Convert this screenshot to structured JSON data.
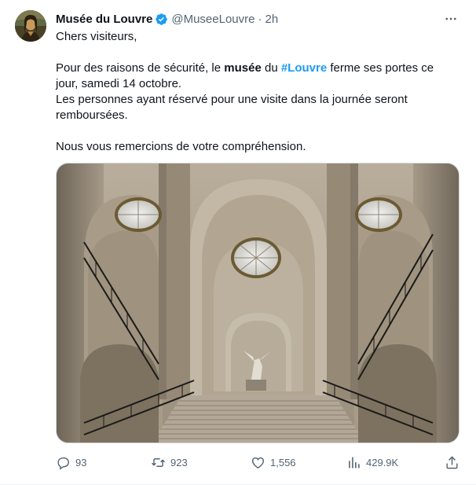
{
  "author": {
    "display_name": "Musée du Louvre",
    "handle": "@MuseeLouvre",
    "separator": "·",
    "time": "2h",
    "avatar_icon": "mona-lisa-avatar",
    "verified_color": "#1d9bf0"
  },
  "tweet": {
    "line1": "Chers visiteurs,",
    "para2": {
      "pre": "Pour des raisons de sécurité, le ",
      "bold": "musée",
      "mid": " du ",
      "hashtag": "#Louvre",
      "post": " ferme ses portes ce jour, samedi 14 octobre."
    },
    "para3": "Les personnes ayant réservé pour une visite dans la journée seront remboursées.",
    "para4": "Nous vous remercions de votre compréhension."
  },
  "media": {
    "icon": "daru-staircase-photo"
  },
  "actions": {
    "replies": "93",
    "retweets": "923",
    "likes": "1,556",
    "views": "429.9K"
  },
  "colors": {
    "text": "#0f1419",
    "secondary": "#536471",
    "accent": "#1d9bf0"
  }
}
